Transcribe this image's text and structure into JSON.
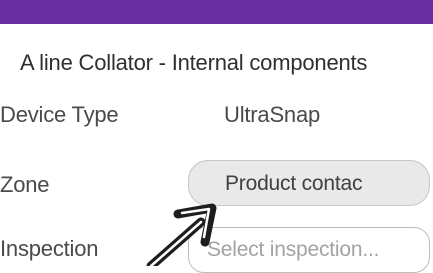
{
  "header": {
    "accent_color": "#6a2fa0"
  },
  "page": {
    "title": "A line Collator - Internal components"
  },
  "form": {
    "device_type": {
      "label": "Device Type",
      "value": "UltraSnap"
    },
    "zone": {
      "label": "Zone",
      "value": "Product contac"
    },
    "inspection": {
      "label": "Inspection",
      "placeholder": "Select inspection..."
    }
  },
  "annotation": {
    "icon": "pointer-arrow-icon",
    "color": "#1e1e1e"
  }
}
